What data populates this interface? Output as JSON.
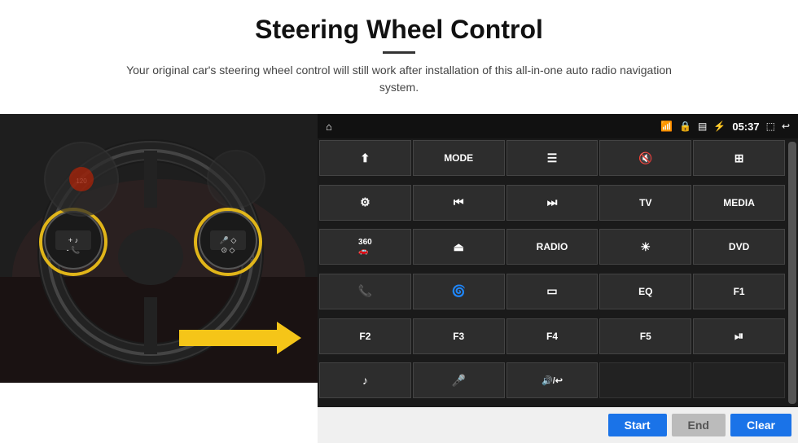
{
  "header": {
    "title": "Steering Wheel Control",
    "description": "Your original car's steering wheel control will still work after installation of this all-in-one auto radio navigation system."
  },
  "status_bar": {
    "time": "05:37",
    "icons": [
      "home",
      "wifi",
      "lock",
      "sim",
      "bluetooth",
      "fullscreen",
      "back"
    ]
  },
  "button_grid": [
    {
      "label": "⬆",
      "type": "icon",
      "row": 1
    },
    {
      "label": "MODE",
      "type": "text",
      "row": 1
    },
    {
      "label": "☰",
      "type": "icon",
      "row": 1
    },
    {
      "label": "🔇",
      "type": "icon",
      "row": 1
    },
    {
      "label": "⊞",
      "type": "icon",
      "row": 1
    },
    {
      "label": "⚙",
      "type": "icon",
      "row": 2
    },
    {
      "label": "⏮",
      "type": "icon",
      "row": 2
    },
    {
      "label": "⏭",
      "type": "icon",
      "row": 2
    },
    {
      "label": "TV",
      "type": "text",
      "row": 2
    },
    {
      "label": "MEDIA",
      "type": "text",
      "row": 2
    },
    {
      "label": "360",
      "type": "text2",
      "row": 3
    },
    {
      "label": "⏏",
      "type": "icon",
      "row": 3
    },
    {
      "label": "RADIO",
      "type": "text",
      "row": 3
    },
    {
      "label": "☀",
      "type": "icon",
      "row": 3
    },
    {
      "label": "DVD",
      "type": "text",
      "row": 3
    },
    {
      "label": "📞",
      "type": "icon",
      "row": 4
    },
    {
      "label": "🌀",
      "type": "icon",
      "row": 4
    },
    {
      "label": "▭",
      "type": "icon",
      "row": 4
    },
    {
      "label": "EQ",
      "type": "text",
      "row": 4
    },
    {
      "label": "F1",
      "type": "text",
      "row": 4
    },
    {
      "label": "F2",
      "type": "text",
      "row": 5
    },
    {
      "label": "F3",
      "type": "text",
      "row": 5
    },
    {
      "label": "F4",
      "type": "text",
      "row": 5
    },
    {
      "label": "F5",
      "type": "text",
      "row": 5
    },
    {
      "label": "⏯",
      "type": "icon",
      "row": 5
    },
    {
      "label": "♪",
      "type": "icon",
      "row": 6
    },
    {
      "label": "🎤",
      "type": "icon",
      "row": 6
    },
    {
      "label": "🔊/↩",
      "type": "icon",
      "row": 6
    },
    {
      "label": "",
      "type": "empty",
      "row": 6
    },
    {
      "label": "",
      "type": "empty",
      "row": 6
    }
  ],
  "bottom_buttons": {
    "start": "Start",
    "end": "End",
    "clear": "Clear"
  }
}
